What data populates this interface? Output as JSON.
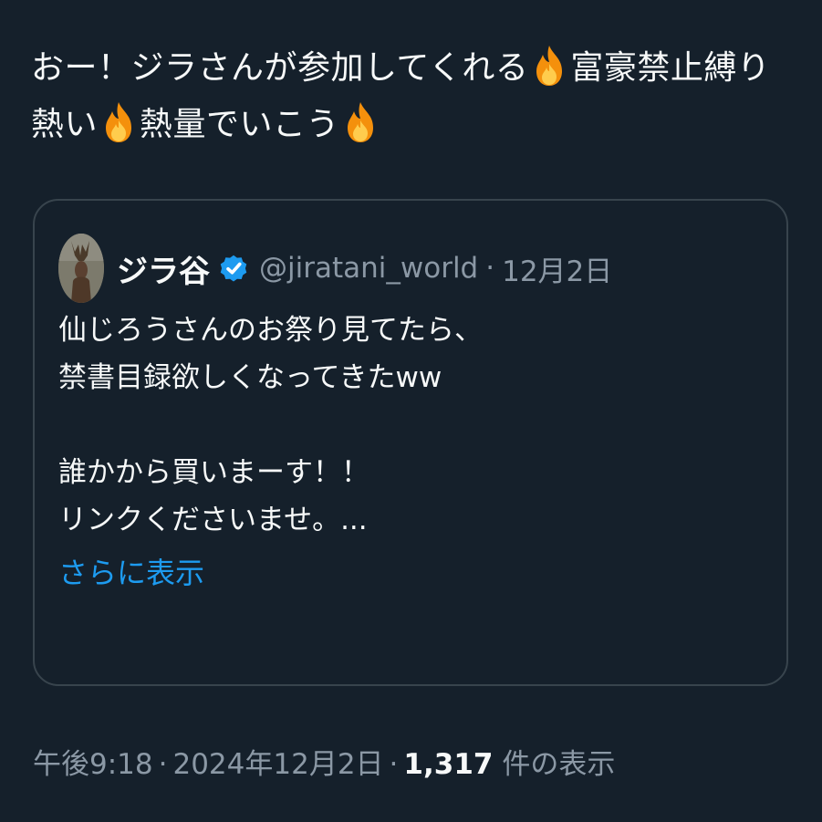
{
  "tweet": {
    "line1_part1": "おー！ジラさんが参加してくれる",
    "line1_part2": "富豪禁止縛り",
    "line2_part1": "熱い",
    "line2_part2": "熱量でいこう"
  },
  "quote": {
    "author_name": "ジラ谷",
    "author_handle": "@jiratani_world",
    "date": "12月2日",
    "lines": [
      "仙じろうさんのお祭り見てたら、",
      "禁書目録欲しくなってきたww",
      "",
      "誰かから買いまーす！！",
      "リンクくださいませ。..."
    ],
    "show_more": "さらに表示"
  },
  "meta": {
    "time": "午後9:18",
    "date": "2024年12月2日",
    "views_count": "1,317",
    "views_label": "件の表示"
  },
  "colors": {
    "background": "#15202b",
    "text": "#f7f9f9",
    "muted": "#8b98a5",
    "accent": "#1d9bf0",
    "border": "#38444d"
  },
  "icons": {
    "fire": "fire-emoji-icon",
    "verified": "verified-badge-icon",
    "avatar": "deer-avatar"
  }
}
